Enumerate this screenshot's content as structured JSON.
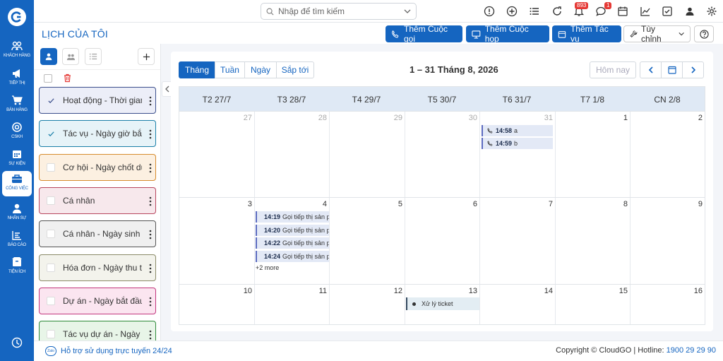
{
  "nav": {
    "items": [
      {
        "label": "KHÁCH HÀNG",
        "icon": "users-icon"
      },
      {
        "label": "TIẾP THỊ",
        "icon": "megaphone-icon"
      },
      {
        "label": "BÁN HÀNG",
        "icon": "cart-icon"
      },
      {
        "label": "CSKH",
        "icon": "support-icon"
      },
      {
        "label": "SỰ KIỆN",
        "icon": "calendar-icon"
      },
      {
        "label": "CÔNG VIỆC",
        "icon": "briefcase-icon",
        "active": true
      },
      {
        "label": "NHÂN SỰ",
        "icon": "person-icon"
      },
      {
        "label": "BÁO CÁO",
        "icon": "report-icon"
      },
      {
        "label": "TIỆN ÍCH",
        "icon": "box-icon"
      }
    ]
  },
  "topbar": {
    "search_placeholder": "Nhập để tìm kiếm",
    "notifications_count": "893",
    "messages_count": "1"
  },
  "header": {
    "title": "LỊCH CỦA TÔI",
    "add_call": "Thêm Cuộc gọi",
    "add_meeting": "Thêm Cuộc họp",
    "add_task": "Thêm Tác vụ",
    "customize": "Tùy chỉnh"
  },
  "sidebar": {
    "categories": [
      {
        "label": "Hoạt động - Thời gian bắt đầu",
        "checked": true,
        "border": "#3c4f8c",
        "bg": "#eceef8"
      },
      {
        "label": "Tác vụ - Ngày giờ bắt đầu",
        "checked": true,
        "border": "#1a7fa8",
        "bg": "#e6f3f8"
      },
      {
        "label": "Cơ hội - Ngày chốt dự kiến",
        "checked": false,
        "border": "#d68b2c",
        "bg": "#fcf0e1"
      },
      {
        "label": "Cá nhân",
        "checked": false,
        "border": "#b8455e",
        "bg": "#f7e8ec"
      },
      {
        "label": "Cá nhân - Ngày sinh",
        "checked": false,
        "border": "#555555",
        "bg": "#f0f0f0"
      },
      {
        "label": "Hóa đơn - Ngày thu tiền",
        "checked": false,
        "border": "#8a8a68",
        "bg": "#f3f3ec"
      },
      {
        "label": "Dự án - Ngày bắt đầu",
        "checked": false,
        "border": "#c2347c",
        "bg": "#fbe5f0"
      },
      {
        "label": "Tác vụ dự án - Ngày bắt đầu",
        "checked": false,
        "border": "#2f8a3a",
        "bg": "#e8f5e8"
      }
    ]
  },
  "calendar": {
    "views": [
      "Tháng",
      "Tuần",
      "Ngày",
      "Sắp tới"
    ],
    "active_view": "Tháng",
    "range_title": "1 – 31 Tháng 8, 2026",
    "today_label": "Hôm nay",
    "weekdays": [
      "T2 27/7",
      "T3 28/7",
      "T4 29/7",
      "T5 30/7",
      "T6 31/7",
      "T7 1/8",
      "CN 2/8"
    ],
    "weeks": [
      [
        "27",
        "28",
        "29",
        "30",
        "31",
        "1",
        "2"
      ],
      [
        "3",
        "4",
        "5",
        "6",
        "7",
        "8",
        "9"
      ],
      [
        "10",
        "11",
        "12",
        "13",
        "14",
        "15",
        "16"
      ]
    ],
    "events": [
      {
        "day": "31",
        "time": "14:58",
        "title": "a"
      },
      {
        "day": "31",
        "time": "14:59",
        "title": "b"
      },
      {
        "day": "4",
        "time": "14:19",
        "title": "Gọi tiếp thị sản phẩm"
      },
      {
        "day": "4",
        "time": "14:20",
        "title": "Gọi tiếp thị sản phẩm"
      },
      {
        "day": "4",
        "time": "14:22",
        "title": "Gọi tiếp thị sản phẩm"
      },
      {
        "day": "4",
        "time": "14:24",
        "title": "Gọi tiếp thị sản phẩm"
      }
    ],
    "more_label": "+2 more",
    "ticket_label": "Xử lý ticket"
  },
  "footer": {
    "support": "Hỗ trợ sử dụng trực tuyến 24/24",
    "zalo": "Zalo",
    "copyright": "Copyright © CloudGO | Hotline: ",
    "hotline": "1900 29 29 90"
  },
  "colors": {
    "primary": "#1565c0",
    "event_bg": "#e3e9f6",
    "header_bg": "#dfe9f5"
  }
}
